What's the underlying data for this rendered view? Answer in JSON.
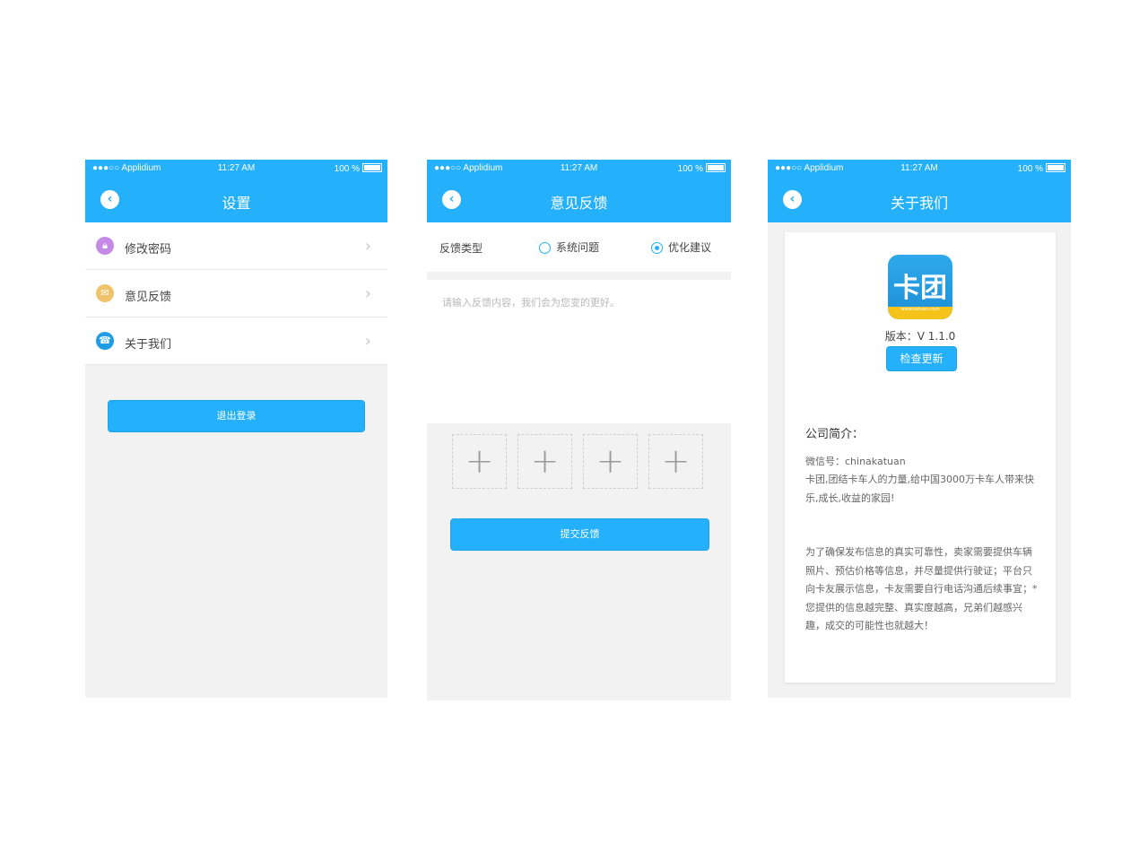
{
  "status_bar": {
    "carrier": "●●●○○ Applidium",
    "time": "11:27 AM",
    "battery": "100 %"
  },
  "screen_settings": {
    "title": "设置",
    "items": [
      {
        "label": "修改密码",
        "icon": "lock-icon",
        "color": "#c58ae6"
      },
      {
        "label": "意见反馈",
        "icon": "envelope-icon",
        "color": "#f0c36a"
      },
      {
        "label": "关于我们",
        "icon": "headset-icon",
        "color": "#1e9de6"
      }
    ],
    "logout_label": "退出登录"
  },
  "screen_feedback": {
    "title": "意见反馈",
    "type_label": "反馈类型",
    "options": [
      {
        "label": "系统问题",
        "checked": false
      },
      {
        "label": "优化建议",
        "checked": true
      }
    ],
    "placeholder": "请输入反馈内容，我们会为您变的更好。",
    "image_slots": [
      "+",
      "+",
      "+",
      "+"
    ],
    "submit_label": "提交反馈"
  },
  "screen_about": {
    "title": "关于我们",
    "logo_text": "卡团",
    "logo_url": "www.katuan.com",
    "version": "版本：V 1.1.0",
    "check_update_label": "检查更新",
    "intro_heading": "公司简介：",
    "wechat": "微信号：chinakatuan",
    "intro": "卡团,团结卡车人的力量,给中国3000万卡车人带来快乐,成长,收益的家园!",
    "notice": "为了确保发布信息的真实可靠性，卖家需要提供车辆照片、预估价格等信息，并尽量提供行驶证；平台只向卡友展示信息，卡友需要自行电话沟通后续事宜；*您提供的信息越完整、真实度越高，兄弟们越感兴趣，成交的可能性也就越大！"
  },
  "colors": {
    "accent": "#24b0fb",
    "background": "#f2f2f2"
  }
}
